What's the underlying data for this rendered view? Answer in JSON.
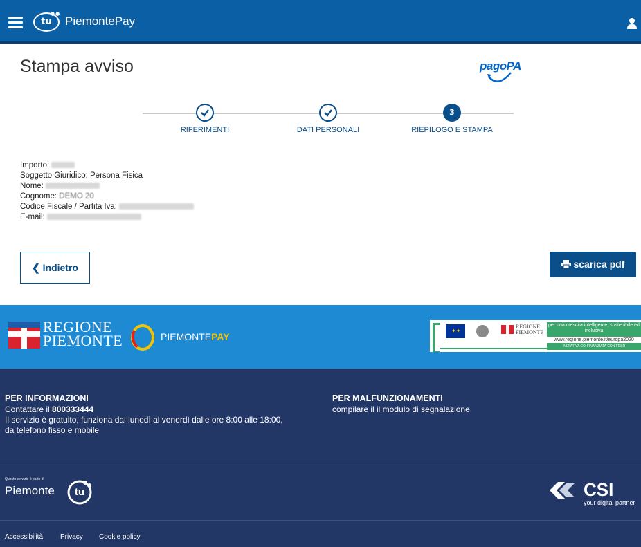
{
  "header": {
    "brand_logo_text": "tu",
    "brand": "PiemontePay",
    "menu_icon": "hamburger-menu-icon",
    "user_icon": "user-icon"
  },
  "page": {
    "title": "Stampa avviso",
    "payment_logo": "pagoPA"
  },
  "stepper": {
    "steps": [
      {
        "label": "RIFERIMENTI",
        "state": "completed"
      },
      {
        "label": "DATI PERSONALI",
        "state": "completed"
      },
      {
        "label": "RIEPILOGO E STAMPA",
        "state": "current",
        "number": "3"
      }
    ]
  },
  "summary": {
    "importo_label": "Importo:",
    "soggetto_label": "Soggetto Giuridico:",
    "soggetto_value": "Persona Fisica",
    "nome_label": "Nome:",
    "cognome_label": "Cognome:",
    "cognome_value": "DEMO 20",
    "codice_label": "Codice Fiscale / Partita Iva:",
    "email_label": "E-mail:"
  },
  "actions": {
    "back_label": "Indietro",
    "back_icon": "chevron-left-icon",
    "pdf_label": "scarica pdf",
    "pdf_icon": "printer-icon"
  },
  "logos": {
    "regione_line1": "REGIONE",
    "regione_line2": "PIEMONTE",
    "piemontepay_part1": "PIEMONTE",
    "piemontepay_part2": "PAY",
    "eu_small_reg_line1": "REGIONE",
    "eu_small_reg_line2": "PIEMONTE",
    "eu_text": "per una crescita intelligente, sostenibile ed inclusiva",
    "eu_url": "www.regione.piemonte.it/europa2020",
    "eu_cofin": "INIZIATIVA CO-FINANZIATA CON FESR"
  },
  "footer": {
    "info_title": "PER INFORMAZIONI",
    "info_contact_prefix": "Contattare il",
    "info_phone": "800333444",
    "info_line2": "Il servizio è gratuito, funziona dal lunedì al venerdì dalle ore 8:00 alle 18:00,",
    "info_line3": "da telefono fisso e mobile",
    "malf_title": "PER MALFUNZIONAMENTI",
    "malf_text": "compilare il il modulo di segnalazione",
    "piemonte_tu_small": "Questo servizio è parte di",
    "piemonte_tu_word": "Piemonte",
    "piemonte_tu_logo": "tu",
    "csi_name": "CSI",
    "csi_tagline": "your digital partner",
    "links": [
      "Accessibilità",
      "Privacy",
      "Cookie policy"
    ]
  },
  "colors": {
    "header_bg": "#0b5fa5",
    "primary": "#0b4f8a",
    "logo_band": "#1e8ad3",
    "footer_bg": "#233767"
  }
}
